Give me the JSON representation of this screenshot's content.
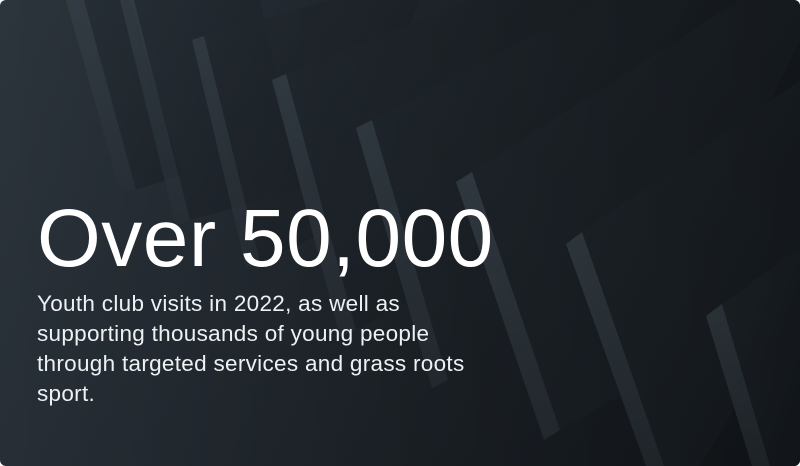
{
  "stat": {
    "headline": "Over 50,000",
    "description": "Youth club visits in 2022, as well as supporting thousands of young people through targeted services and grass roots sport."
  },
  "colors": {
    "background": "#242b32",
    "panel_face": "#1f262c",
    "panel_edge": "#3a444d",
    "text": "#ffffff"
  },
  "icons": {
    "background": "abstract-angled-panels-image"
  }
}
